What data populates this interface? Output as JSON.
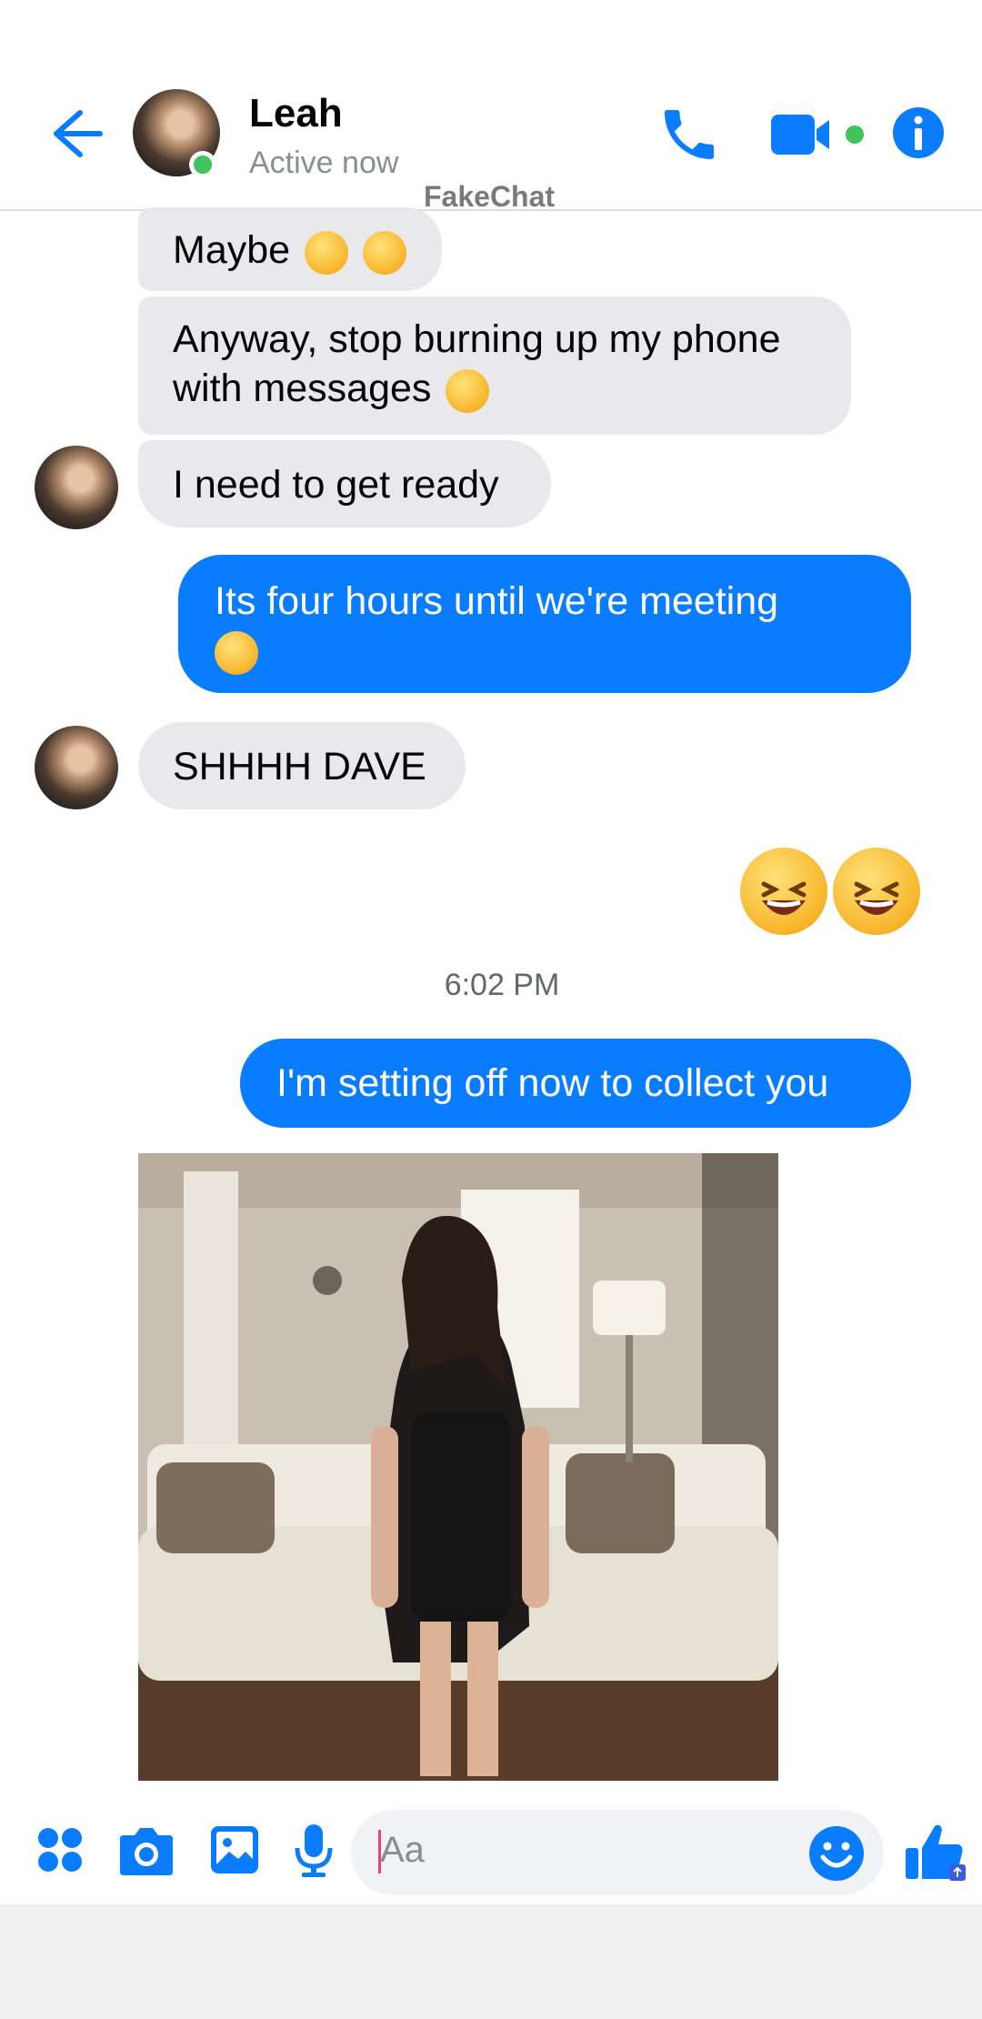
{
  "header": {
    "contact_name": "Leah",
    "status": "Active now",
    "watermark": "FakeChat",
    "icons": [
      "back-arrow-icon",
      "phone-icon",
      "video-camera-icon",
      "info-icon"
    ],
    "accent_color": "#0a7cff",
    "online_color": "#3fc35a"
  },
  "messages": [
    {
      "side": "in",
      "text": "Maybe",
      "emoji": [
        "face-with-rolling-eyes",
        "face-with-tears-of-joy"
      ]
    },
    {
      "side": "in",
      "text": "Anyway, stop burning up my phone with messages",
      "emoji": [
        "face-with-tears-of-joy"
      ]
    },
    {
      "side": "in",
      "text": "I need to get ready"
    },
    {
      "side": "out",
      "text": "Its four hours until we're meeting",
      "emoji": [
        "thinking-face"
      ]
    },
    {
      "side": "in",
      "text": "SHHHH DAVE"
    },
    {
      "side": "out",
      "emoji_only": [
        "rolling-on-the-floor-laughing",
        "rolling-on-the-floor-laughing"
      ]
    },
    {
      "side": "out",
      "text": "I'm setting off now to collect you"
    },
    {
      "side": "in",
      "type": "photo"
    }
  ],
  "timestamp": "6:02 PM",
  "composer": {
    "placeholder": "Aa",
    "icons": [
      "apps-icon",
      "camera-icon",
      "gallery-icon",
      "microphone-icon",
      "emoji-icon",
      "thumbs-up-icon"
    ]
  }
}
